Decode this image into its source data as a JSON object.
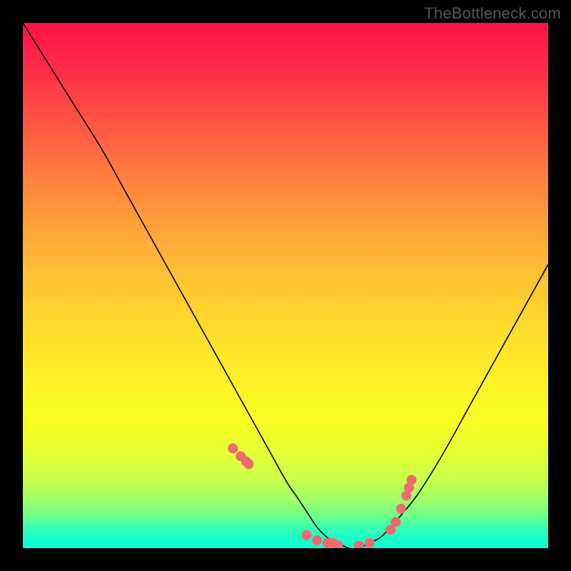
{
  "watermark": "TheBottleneck.com",
  "chart_data": {
    "type": "line",
    "title": "",
    "xlabel": "",
    "ylabel": "",
    "xlim": [
      0,
      100
    ],
    "ylim": [
      0,
      100
    ],
    "series": [
      {
        "name": "bottleneck-curve",
        "x": [
          0,
          5,
          10,
          15,
          20,
          25,
          30,
          35,
          40,
          45,
          50,
          52,
          54,
          56,
          58,
          60,
          62,
          64,
          66,
          68,
          70,
          75,
          80,
          85,
          90,
          95,
          100
        ],
        "y": [
          100,
          92,
          84,
          76,
          67,
          58,
          49,
          40,
          31,
          22,
          13,
          10,
          7,
          4,
          2,
          1,
          0,
          0,
          1,
          2,
          4,
          10,
          18,
          27,
          36,
          45,
          54
        ]
      }
    ],
    "markers": {
      "name": "highlight-points",
      "color": "#ee6a6e",
      "x": [
        40,
        41.5,
        42.5,
        43,
        54,
        56,
        58,
        59,
        60,
        64,
        66,
        70,
        71,
        72,
        73,
        73.5,
        74
      ],
      "y": [
        19,
        17.5,
        16.5,
        16,
        2.5,
        1.5,
        1,
        1,
        0.5,
        0.5,
        1,
        3.5,
        5,
        7.5,
        10,
        11.5,
        13
      ]
    },
    "gradient_stops": [
      {
        "pos": 0,
        "color": "#ff1148"
      },
      {
        "pos": 50,
        "color": "#ffd529"
      },
      {
        "pos": 100,
        "color": "#0bffd4"
      }
    ]
  }
}
